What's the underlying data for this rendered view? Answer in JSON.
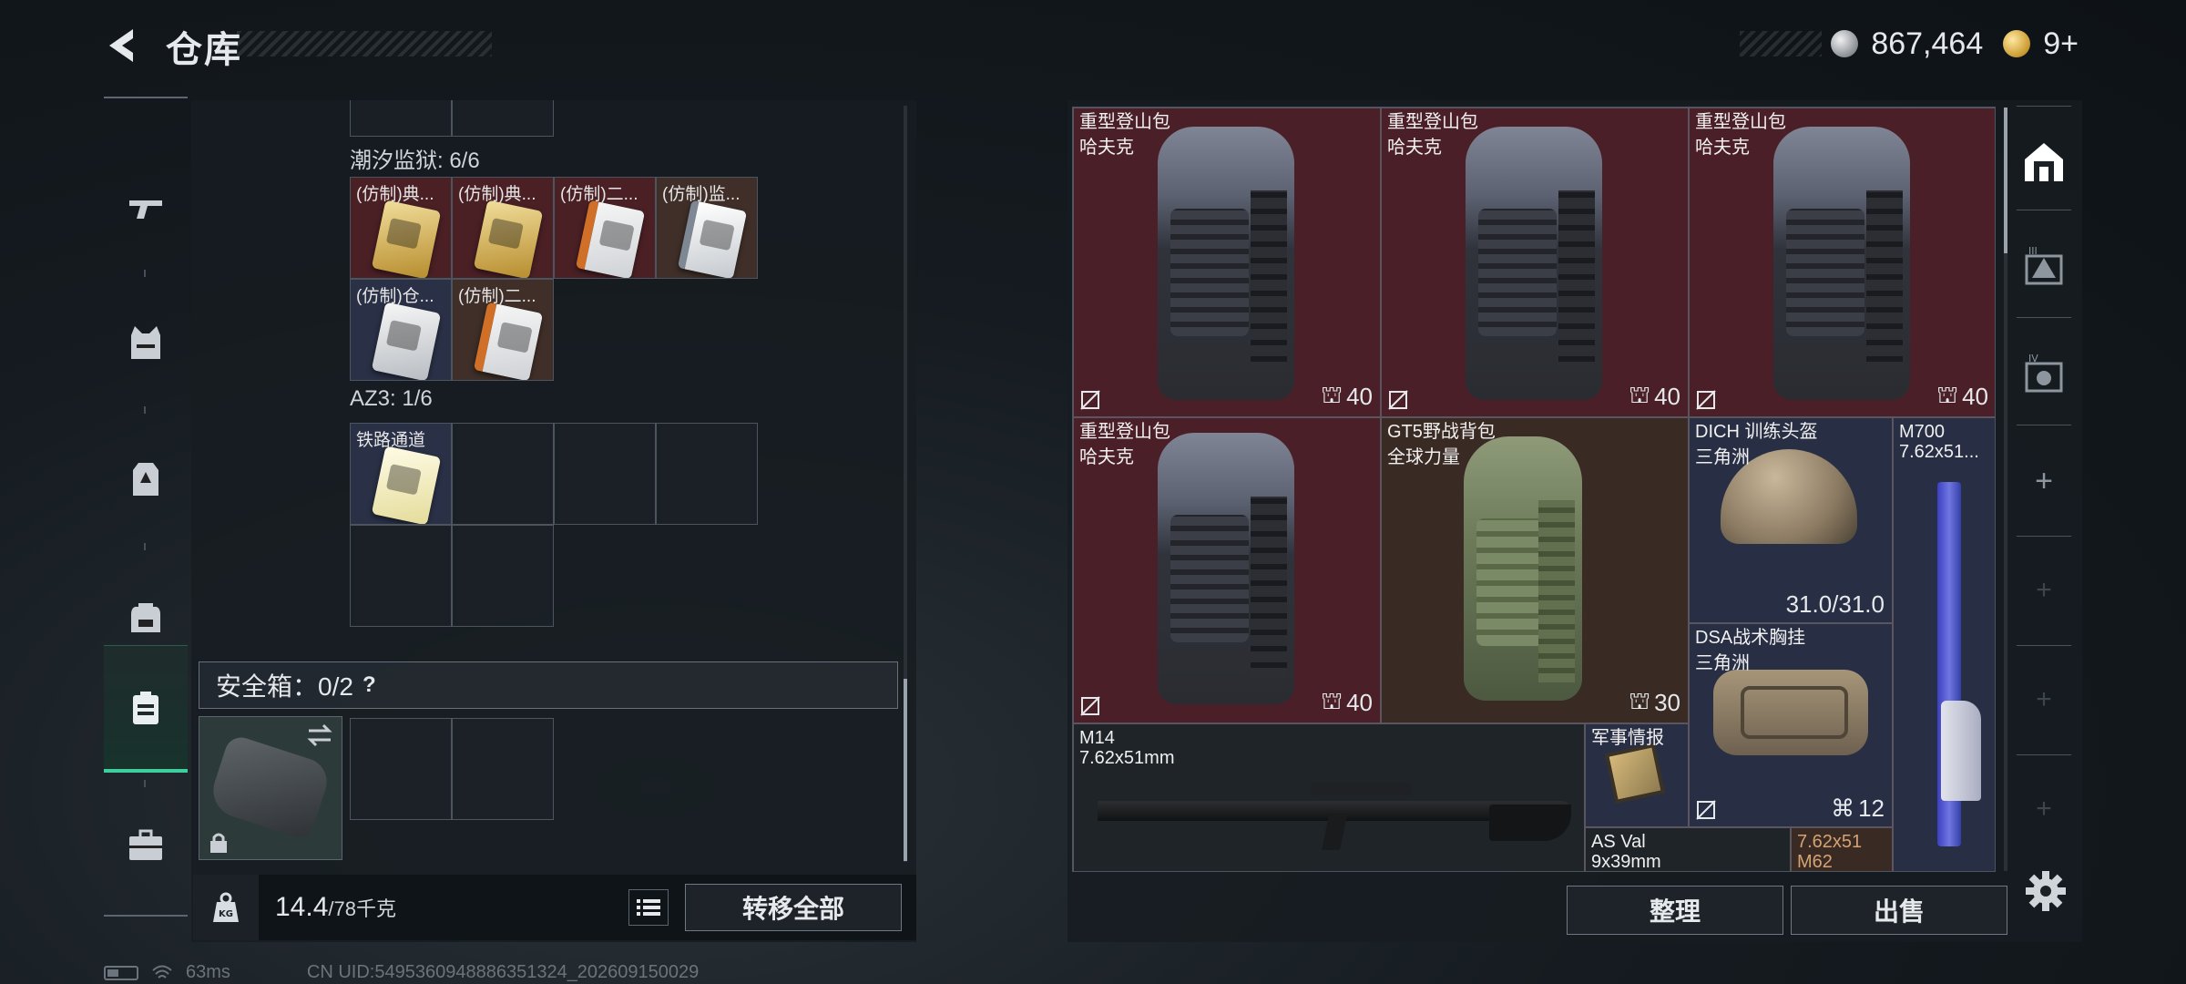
{
  "header": {
    "title": "仓库",
    "currency_silver": "867,464",
    "currency_gold": "9+"
  },
  "nav": {
    "items": [
      "weapons-icon",
      "vest-icon",
      "armor-icon",
      "backpack-icon",
      "safebox-icon",
      "briefcase-icon"
    ],
    "active": "safebox-icon"
  },
  "left": {
    "section1": {
      "label": "潮汐监狱: 6/6",
      "items": [
        "(仿制)典...",
        "(仿制)典...",
        "(仿制)二...",
        "(仿制)监...",
        "(仿制)仓...",
        "(仿制)二..."
      ]
    },
    "section2": {
      "label": "AZ3: 1/6",
      "items": [
        "铁路通道"
      ]
    },
    "safe_box": {
      "label": "安全箱：0/2",
      "help": "?"
    },
    "weight": {
      "value": "14.4",
      "max": "/78千克",
      "kg_badge": "KG"
    },
    "transfer_all": "转移全部"
  },
  "status": {
    "ping": "63ms",
    "uid": "CN UID:5495360948886351324_202609150029"
  },
  "grid": {
    "items": [
      {
        "name": "重型登山包",
        "sub": "哈夫克",
        "capacity": "40"
      },
      {
        "name": "重型登山包",
        "sub": "哈夫克",
        "capacity": "40"
      },
      {
        "name": "重型登山包",
        "sub": "哈夫克",
        "capacity": "40"
      },
      {
        "name": "重型登山包",
        "sub": "哈夫克",
        "capacity": "40"
      },
      {
        "name": "GT5野战背包",
        "sub": "全球力量",
        "capacity": "30"
      },
      {
        "name": "DICH 训练头盔",
        "sub": "三角洲",
        "durability": "31.0/31.0"
      },
      {
        "name": "M700",
        "sub": "7.62x51..."
      },
      {
        "name": "DSA战术胸挂",
        "sub": "三角洲",
        "capacity": "12"
      },
      {
        "name": "M14",
        "sub": "7.62x51mm"
      },
      {
        "name": "军事情报"
      },
      {
        "name": "AS Val",
        "sub": "9x39mm"
      },
      {
        "name": "7.62x51",
        "sub": "M62"
      }
    ]
  },
  "actions": {
    "sort": "整理",
    "sell": "出售"
  },
  "colors": {
    "accent": "#3fcf9e",
    "item_red": "#4b1f27",
    "item_brown": "#3a2a24",
    "item_navy": "#282e44"
  }
}
